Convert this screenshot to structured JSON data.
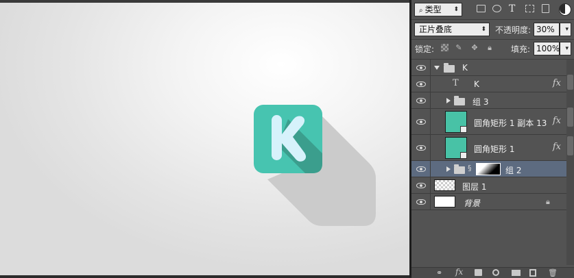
{
  "filter": {
    "kind_label": "类型",
    "icons": [
      "image-filter-icon",
      "adjustment-filter-icon",
      "type-filter-icon",
      "shape-filter-icon",
      "smart-object-filter-icon"
    ]
  },
  "blend": {
    "mode": "正片叠底",
    "opacity_label": "不透明度:",
    "opacity_value": "30%"
  },
  "lock": {
    "label": "锁定:",
    "fill_label": "填充:",
    "fill_value": "100%"
  },
  "layers": [
    {
      "name": "K",
      "kind": "group",
      "expanded": true,
      "indent": 0
    },
    {
      "name": "K",
      "kind": "text",
      "fx": "fx",
      "indent": 1
    },
    {
      "name": "组 3",
      "kind": "group",
      "expanded": false,
      "indent": 1
    },
    {
      "name": "圆角矩形 1 副本 13",
      "kind": "shape",
      "fx": "fx",
      "indent": 1
    },
    {
      "name": "圆角矩形 1",
      "kind": "shape",
      "fx": "fx",
      "indent": 1
    },
    {
      "name": "组 2",
      "kind": "group-masked",
      "expanded": false,
      "indent": 1,
      "selected": true
    },
    {
      "name": "图层 1",
      "kind": "pixel",
      "indent": 0
    },
    {
      "name": "背景",
      "kind": "background",
      "locked": true,
      "indent": 0
    }
  ],
  "canvas": {
    "logo_letter": "K",
    "colors": {
      "tile": "#48c4b0",
      "tile_dark": "#3a9c8a",
      "letter": "#d5f1fb",
      "shadow": "#c9c9c9"
    }
  },
  "bottom_icons": [
    "link-layers-icon",
    "fx-icon",
    "add-mask-icon",
    "new-adjustment-icon",
    "new-group-icon",
    "new-layer-icon",
    "delete-layer-icon"
  ],
  "bottom_fx": "fx"
}
